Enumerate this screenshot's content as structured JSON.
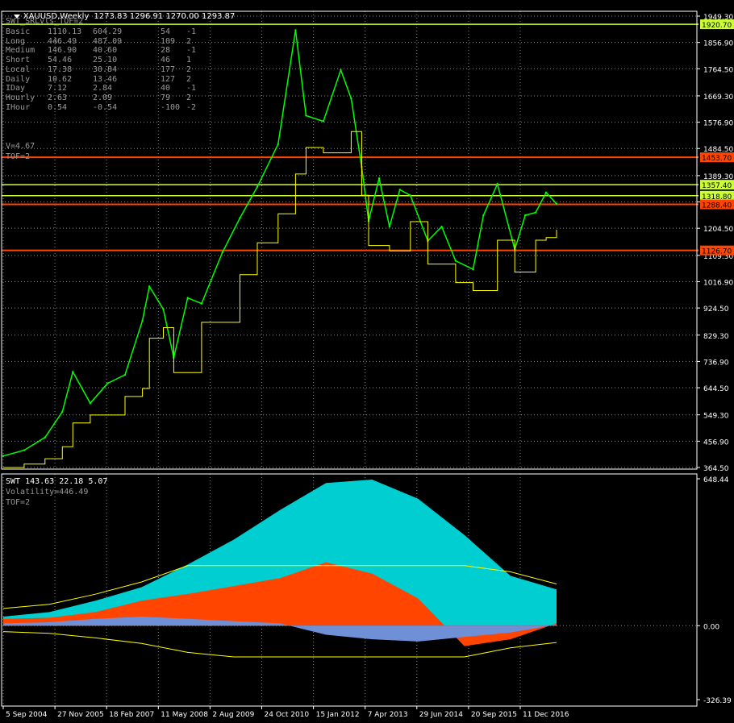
{
  "window": {
    "symbol": "XAUUSD,Weekly",
    "ohlc": "1273.83 1296.91 1270.00 1293.87"
  },
  "indicator": {
    "title": "SWT_SRLvls_TOF=2",
    "rows": [
      {
        "label": "Basic",
        "v1": "1110.13",
        "v2": "604.29",
        "v3": "54",
        "v4": "-1"
      },
      {
        "label": "Long",
        "v1": "446.49",
        "v2": "487.09",
        "v3": "109",
        "v4": "2"
      },
      {
        "label": "Medium",
        "v1": "146.90",
        "v2": "40.60",
        "v3": "28",
        "v4": "-1"
      },
      {
        "label": "Short",
        "v1": "54.46",
        "v2": "25.10",
        "v3": "46",
        "v4": "1"
      },
      {
        "label": "Local",
        "v1": "17.38",
        "v2": "30.84",
        "v3": "177",
        "v4": "2"
      },
      {
        "label": "Daily",
        "v1": "10.62",
        "v2": "13.46",
        "v3": "127",
        "v4": "2"
      },
      {
        "label": "IDay",
        "v1": "7.12",
        "v2": "2.84",
        "v3": "40",
        "v4": "-1"
      },
      {
        "label": "Hourly",
        "v1": "2.63",
        "v2": "2.09",
        "v3": "79",
        "v4": "2"
      },
      {
        "label": "IHour",
        "v1": "0.54",
        "v2": "-0.54",
        "v3": "-100",
        "v4": "-2"
      }
    ],
    "v_line": "V=4.67",
    "tof_line": "TOF=2"
  },
  "subwindow": {
    "header": "SWT 143.63 22.18 5.07",
    "volatility": "Volatility=446.49",
    "tof": "TOF=2"
  },
  "colors": {
    "background": "#000000",
    "price_line": "#00ff00",
    "yellow": "#ffff00",
    "yellow_green": "#ccff33",
    "red_level": "#ff4500",
    "cyan": "#00ced1",
    "orange_fill": "#ff4500",
    "blue_fill": "#6f8fd6",
    "grid": "#8a8a8a",
    "axis_text": "#ffffff"
  },
  "chart_data": [
    {
      "type": "line",
      "title": "XAUUSD,Weekly",
      "x_labels": [
        "5 Sep 2004",
        "27 Nov 2005",
        "18 Feb 2007",
        "11 May 2008",
        "2 Aug 2009",
        "24 Oct 2010",
        "15 Jan 2012",
        "7 Apr 2013",
        "29 Jun 2014",
        "20 Sep 2015",
        "11 Dec 2016"
      ],
      "y_ticks": [
        "1949.30",
        "1856.90",
        "1764.50",
        "1669.30",
        "1576.90",
        "1484.50",
        "1389.30",
        "1296.90",
        "1204.50",
        "1109.30",
        "1016.90",
        "924.50",
        "829.30",
        "736.90",
        "644.50",
        "549.30",
        "456.90",
        "364.50"
      ],
      "ylim": [
        364.5,
        1949.3
      ],
      "grid": true,
      "series": [
        {
          "x": [
            "2004-09",
            "2005-03",
            "2005-09",
            "2006-02",
            "2006-05",
            "2006-10",
            "2007-03",
            "2007-08",
            "2008-01",
            "2008-03",
            "2008-07",
            "2008-10",
            "2009-02",
            "2009-06",
            "2009-12",
            "2010-05",
            "2010-10",
            "2011-04",
            "2011-09",
            "2011-12",
            "2012-05",
            "2012-10",
            "2013-01",
            "2013-04",
            "2013-06",
            "2013-09",
            "2013-12",
            "2014-03",
            "2014-06",
            "2014-11",
            "2015-03",
            "2015-07",
            "2015-12",
            "2016-03",
            "2016-07",
            "2016-12",
            "2017-03",
            "2017-06",
            "2017-09",
            "2017-12"
          ],
          "values": [
            405,
            425,
            470,
            560,
            700,
            590,
            660,
            690,
            880,
            1000,
            920,
            750,
            960,
            940,
            1120,
            1240,
            1350,
            1500,
            1900,
            1600,
            1580,
            1760,
            1660,
            1420,
            1230,
            1380,
            1210,
            1340,
            1320,
            1160,
            1210,
            1090,
            1060,
            1250,
            1360,
            1130,
            1250,
            1260,
            1330,
            1290
          ]
        }
      ],
      "levels": [
        {
          "value": 1920.7,
          "label": "1920.70",
          "color": "#ccff33"
        },
        {
          "value": 1453.7,
          "label": "1453.70",
          "color": "#ff4500"
        },
        {
          "value": 1357.4,
          "label": "1357.40",
          "color": "#ccff33"
        },
        {
          "value": 1318.8,
          "label": "1318.80",
          "color": "#ccff33"
        },
        {
          "value": 1288.4,
          "label": "1288.40",
          "color": "#ff4500"
        },
        {
          "value": 1126.7,
          "label": "1126.70",
          "color": "#ff4500"
        }
      ]
    },
    {
      "type": "area",
      "title": "SWT 143.63 22.18 5.07",
      "y_ticks": [
        "648.44",
        "0.00",
        "-326.39"
      ],
      "ylim": [
        -326.39,
        648.44
      ],
      "series": [
        {
          "name": "Volatility",
          "values": [
            40,
            60,
            110,
            170,
            270,
            380,
            510,
            630,
            645,
            560,
            400,
            220,
            160
          ]
        },
        {
          "name": "Orange",
          "values": [
            30,
            35,
            60,
            110,
            140,
            175,
            210,
            280,
            230,
            120,
            -90,
            -60,
            10
          ]
        },
        {
          "name": "Blue",
          "values": [
            10,
            15,
            30,
            40,
            30,
            20,
            10,
            -40,
            -60,
            -70,
            -50,
            -30,
            5
          ]
        }
      ]
    }
  ]
}
